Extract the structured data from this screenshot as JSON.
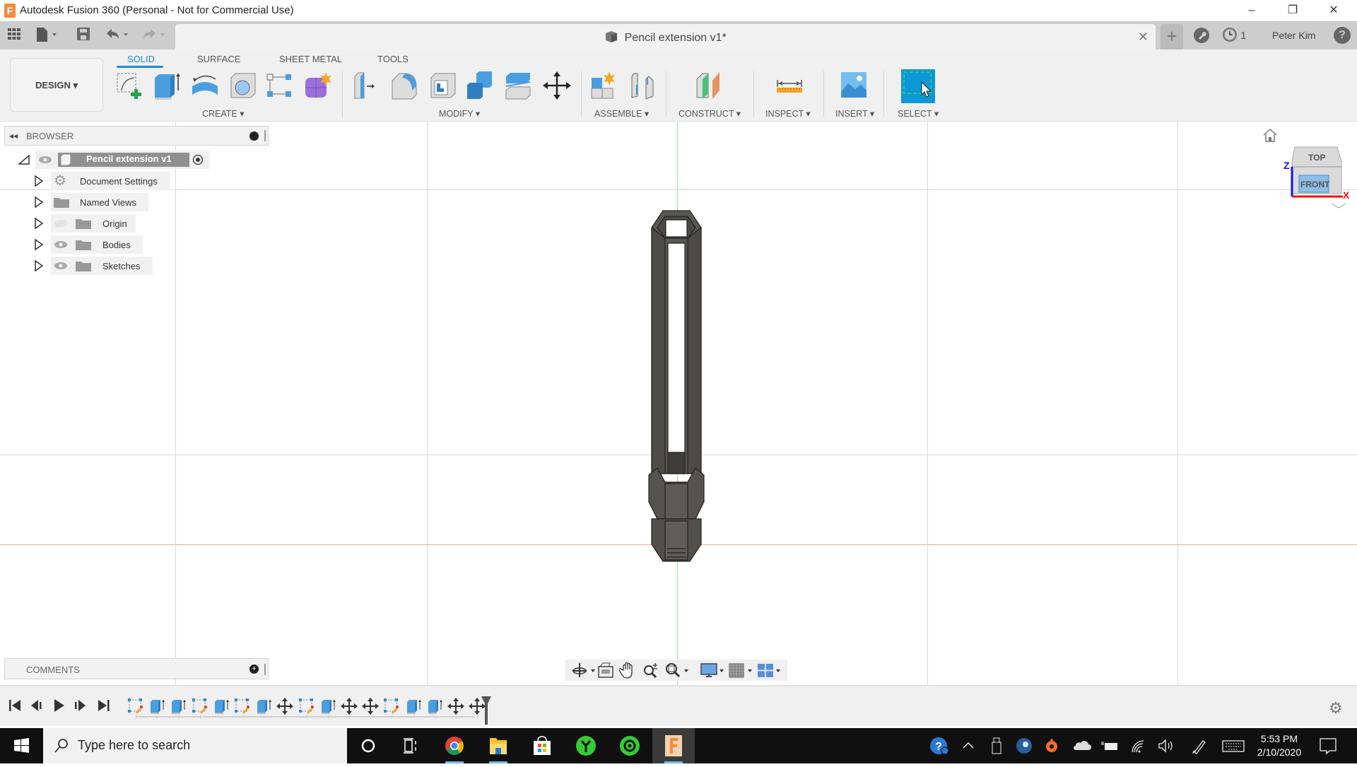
{
  "window": {
    "title": "Autodesk Fusion 360 (Personal - Not for Commercial Use)",
    "app_icon": "F",
    "controls": {
      "minimize": "–",
      "restore": "❐",
      "close": "✕"
    }
  },
  "quick_access": {
    "icons": [
      "grid-apps-icon",
      "file-icon",
      "save-icon",
      "undo-icon",
      "redo-icon"
    ],
    "document_tab": {
      "title": "Pencil extension v1*",
      "close": "✕"
    },
    "new_tab": "+",
    "jobs_count": "1",
    "user_name": "Peter Kim",
    "help": "?"
  },
  "ribbon": {
    "workspace": "DESIGN ▾",
    "tabs": [
      {
        "label": "SOLID",
        "active": true
      },
      {
        "label": "SURFACE",
        "active": false
      },
      {
        "label": "SHEET METAL",
        "active": false
      },
      {
        "label": "TOOLS",
        "active": false
      }
    ],
    "groups": [
      {
        "label": "CREATE ▾",
        "tools": [
          "create-sketch",
          "extrude",
          "revolve",
          "hole",
          "pattern",
          "create-form"
        ]
      },
      {
        "label": "MODIFY ▾",
        "tools": [
          "press-pull",
          "fillet",
          "shell",
          "combine",
          "offset-face",
          "move-copy"
        ]
      },
      {
        "label": "ASSEMBLE ▾",
        "tools": [
          "new-component",
          "joint"
        ]
      },
      {
        "label": "CONSTRUCT ▾",
        "tools": [
          "offset-plane"
        ]
      },
      {
        "label": "INSPECT ▾",
        "tools": [
          "measure"
        ]
      },
      {
        "label": "INSERT ▾",
        "tools": [
          "insert-image"
        ]
      },
      {
        "label": "SELECT ▾",
        "tools": [
          "select"
        ]
      }
    ],
    "accent_color": "#1a8cd8"
  },
  "browser": {
    "title": "BROWSER",
    "root": {
      "label": "Pencil extension v1"
    },
    "items": [
      {
        "label": "Document Settings",
        "icon": "gear-icon",
        "visible": null
      },
      {
        "label": "Named Views",
        "icon": "folder-icon",
        "visible": null
      },
      {
        "label": "Origin",
        "icon": "folder-icon",
        "visible": false
      },
      {
        "label": "Bodies",
        "icon": "folder-icon",
        "visible": true
      },
      {
        "label": "Sketches",
        "icon": "folder-icon",
        "visible": true
      }
    ]
  },
  "comments": {
    "title": "COMMENTS"
  },
  "viewcube": {
    "top": "TOP",
    "front": "FRONT",
    "axis_x": "X",
    "axis_z": "Z"
  },
  "navbar": {
    "tools": [
      "orbit",
      "look-at",
      "pan",
      "zoom",
      "fit",
      "display-settings",
      "grid-snaps",
      "viewports"
    ]
  },
  "timeline": {
    "controls": [
      "go-to-start",
      "step-back",
      "play",
      "step-forward",
      "go-to-end"
    ],
    "features": [
      "sketch",
      "extrude",
      "extrude",
      "sketch",
      "extrude",
      "sketch",
      "extrude",
      "move",
      "sketch",
      "extrude",
      "move",
      "move",
      "sketch",
      "extrude",
      "extrude",
      "move",
      "move"
    ]
  },
  "taskbar": {
    "search_placeholder": "Type here to search",
    "pinned": [
      "cortana",
      "task-view",
      "chrome",
      "file-explorer",
      "store",
      "app-green-1",
      "app-green-2",
      "fusion-360"
    ],
    "tray": [
      "help-icon",
      "show-hidden",
      "usb",
      "steam",
      "origin",
      "onedrive",
      "battery",
      "wifi",
      "volume",
      "pen",
      "keyboard"
    ],
    "time": "5:53 PM",
    "date": "2/10/2020"
  }
}
